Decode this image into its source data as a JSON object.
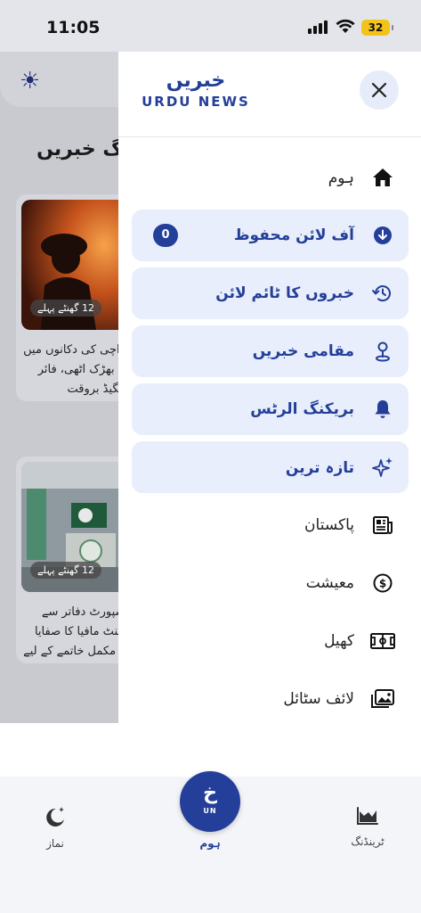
{
  "status_bar": {
    "time": "11:05",
    "battery": "32"
  },
  "background": {
    "section_title": "ٹرینڈنگ خبریں",
    "cards": [
      {
        "time": "12 گھنٹے پہلے",
        "text": "کراچی کی دکانوں میں آگ بھڑک اٹھی، فائر بریگیڈ بروقت کارروائی..."
      },
      {
        "time": "12 گھنٹے پہلے",
        "text": "پاسپورٹ دفاتر سے ایجنٹ مافیا کا صفایا کے مکمل خاتمے کے لیے ایف آئی اے..."
      }
    ]
  },
  "drawer": {
    "brand_urdu": "خبریں",
    "brand_en": "URDU NEWS",
    "items": [
      {
        "label": "ہوم",
        "icon": "home-icon",
        "highlight": false
      },
      {
        "label": "آف لائن محفوظ",
        "icon": "download-icon",
        "highlight": true,
        "count": "0"
      },
      {
        "label": "خبروں کا ٹائم لائن",
        "icon": "history-icon",
        "highlight": true
      },
      {
        "label": "مقامی خبریں",
        "icon": "location-icon",
        "highlight": true
      },
      {
        "label": "بریکنگ الرٹس",
        "icon": "bell-icon",
        "highlight": true
      },
      {
        "label": "تازہ ترین",
        "icon": "sparkle-icon",
        "highlight": true
      },
      {
        "label": "پاکستان",
        "icon": "newspaper-icon",
        "highlight": false
      },
      {
        "label": "معیشت",
        "icon": "dollar-icon",
        "highlight": false
      },
      {
        "label": "کھیل",
        "icon": "stadium-icon",
        "highlight": false
      },
      {
        "label": "لائف سٹائل",
        "icon": "gallery-icon",
        "highlight": false
      }
    ]
  },
  "bottom_nav": {
    "prayer": "نماز",
    "home": "ہوم",
    "trending": "ٹرینڈنگ",
    "home_glyph": "خ",
    "home_sub": "UN"
  },
  "colors": {
    "accent": "#243f99",
    "highlight_bg": "#e8eefb",
    "dim_bg": "#c9cacf"
  }
}
